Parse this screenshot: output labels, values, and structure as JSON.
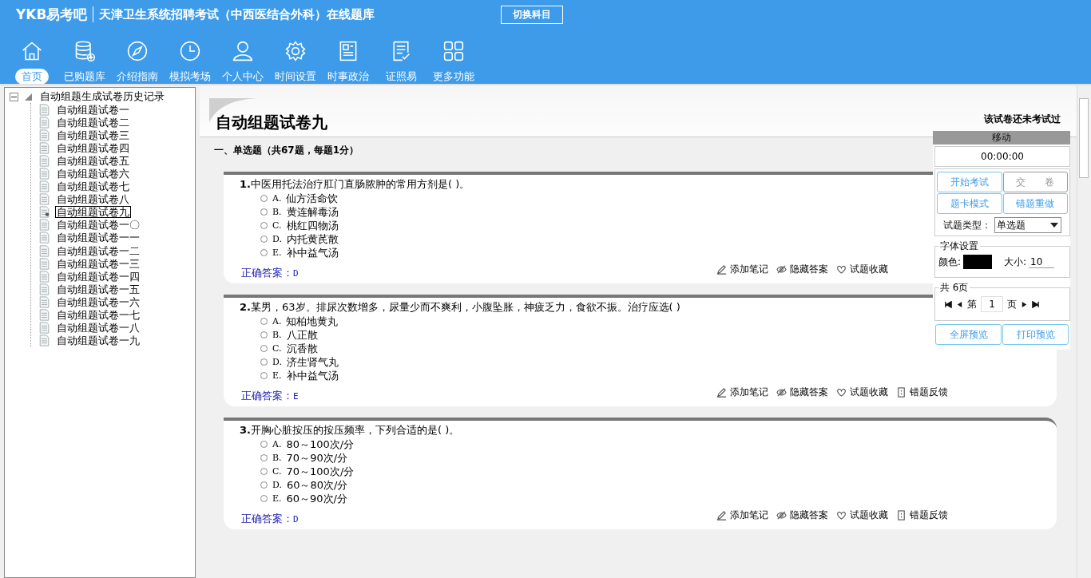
{
  "header": {
    "logo": "YKB易考吧",
    "title": "天津卫生系统招聘考试（中西医结合外科）在线题库",
    "switch_button": "切换科目"
  },
  "nav": [
    {
      "label": "首页",
      "selected": true
    },
    {
      "label": "已购题库",
      "selected": false
    },
    {
      "label": "介绍指南",
      "selected": false
    },
    {
      "label": "模拟考场",
      "selected": false
    },
    {
      "label": "个人中心",
      "selected": false
    },
    {
      "label": "时间设置",
      "selected": false
    },
    {
      "label": "时事政治",
      "selected": false
    },
    {
      "label": "证照易",
      "selected": false
    },
    {
      "label": "更多功能",
      "selected": false
    }
  ],
  "tree": {
    "label": "自动组题生成试卷历史记录",
    "expanded": true,
    "children": [
      {
        "label": "自动组题试卷一",
        "selected": false
      },
      {
        "label": "自动组题试卷二",
        "selected": false
      },
      {
        "label": "自动组题试卷三",
        "selected": false
      },
      {
        "label": "自动组题试卷四",
        "selected": false
      },
      {
        "label": "自动组题试卷五",
        "selected": false
      },
      {
        "label": "自动组题试卷六",
        "selected": false
      },
      {
        "label": "自动组题试卷七",
        "selected": false
      },
      {
        "label": "自动组题试卷八",
        "selected": false
      },
      {
        "label": "自动组题试卷九",
        "selected": true
      },
      {
        "label": "自动组题试卷一〇",
        "selected": false
      },
      {
        "label": "自动组题试卷一一",
        "selected": false
      },
      {
        "label": "自动组题试卷一二",
        "selected": false
      },
      {
        "label": "自动组题试卷一三",
        "selected": false
      },
      {
        "label": "自动组题试卷一四",
        "selected": false
      },
      {
        "label": "自动组题试卷一五",
        "selected": false
      },
      {
        "label": "自动组题试卷一六",
        "selected": false
      },
      {
        "label": "自动组题试卷一七",
        "selected": false
      },
      {
        "label": "自动组题试卷一八",
        "selected": false
      },
      {
        "label": "自动组题试卷一九",
        "selected": false
      }
    ]
  },
  "paper": {
    "title": "自动组题试卷九",
    "status": "该试卷还未考试过",
    "section": "一、单选题（共67题，每题1分）"
  },
  "questions": [
    {
      "number": "1.",
      "text": "中医用托法治疗肛门直肠脓肿的常用方剂是( )。",
      "options": [
        {
          "letter": "A.",
          "text": "仙方活命饮",
          "checked": false
        },
        {
          "letter": "B.",
          "text": "黄连解毒汤",
          "checked": false
        },
        {
          "letter": "C.",
          "text": "桃红四物汤",
          "checked": false
        },
        {
          "letter": "D.",
          "text": "内托黄芪散",
          "checked": false
        },
        {
          "letter": "E.",
          "text": "补中益气汤",
          "checked": false
        }
      ],
      "actions": [
        "添加笔记",
        "隐藏答案",
        "试题收藏"
      ],
      "answer_label": "正确答案：",
      "answer": "D"
    },
    {
      "number": "2.",
      "text": "某男，63岁。排尿次数增多，尿量少而不爽利，小腹坠胀，神疲乏力，食欲不振。治疗应选( )",
      "options": [
        {
          "letter": "A.",
          "text": "知柏地黄丸",
          "checked": false
        },
        {
          "letter": "B.",
          "text": "八正散",
          "checked": false
        },
        {
          "letter": "C.",
          "text": "沉香散",
          "checked": false
        },
        {
          "letter": "D.",
          "text": "济生肾气丸",
          "checked": false
        },
        {
          "letter": "E.",
          "text": "补中益气汤",
          "checked": false
        }
      ],
      "actions": [
        "添加笔记",
        "隐藏答案",
        "试题收藏",
        "错题反馈"
      ],
      "answer_label": "正确答案：",
      "answer": "E"
    },
    {
      "number": "3.",
      "text": "开胸心脏按压的按压频率，下列合适的是( )。",
      "options": [
        {
          "letter": "A.",
          "text": "80～100次/分",
          "checked": false
        },
        {
          "letter": "B.",
          "text": "70～90次/分",
          "checked": false
        },
        {
          "letter": "C.",
          "text": "70～100次/分",
          "checked": false
        },
        {
          "letter": "D.",
          "text": "60～80次/分",
          "checked": false
        },
        {
          "letter": "E.",
          "text": "60～90次/分",
          "checked": false
        }
      ],
      "actions": [
        "添加笔记",
        "隐藏答案",
        "试题收藏",
        "错题反馈"
      ],
      "answer_label": "正确答案：",
      "answer": "D"
    }
  ],
  "panel": {
    "title": "移动",
    "timer": "00:00:00",
    "buttons": [
      {
        "label": "开始考试",
        "disabled": false
      },
      {
        "label": "交　　卷",
        "disabled": true
      },
      {
        "label": "题卡模式",
        "disabled": false
      },
      {
        "label": "错题重做",
        "disabled": false
      }
    ],
    "type_label": "试题类型：",
    "type_value": "单选题",
    "font_legend": "字体设置",
    "color_label": "颜色:",
    "size_label": "大小:",
    "size_value": "10",
    "pager_legend": "共 6页",
    "page_prefix": "第",
    "page_value": "1",
    "page_suffix": "页",
    "bottom_buttons": [
      "全屏预览",
      "打印预览"
    ]
  }
}
